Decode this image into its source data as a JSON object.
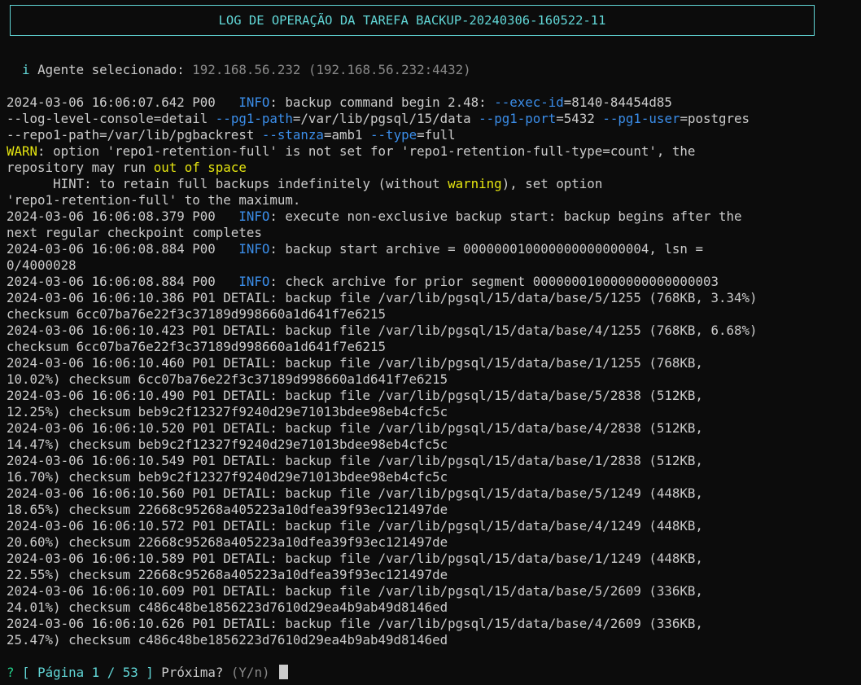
{
  "title": "LOG DE OPERAÇÃO DA TAREFA BACKUP-20240306-160522-11",
  "agent": {
    "icon_text": "i",
    "label": "Agente selecionado:",
    "value": "192.168.56.232 (192.168.56.232:4432)"
  },
  "log_lines": [
    [
      {
        "t": "2024-03-06 16:06:07.642 P00   "
      },
      {
        "t": "INFO",
        "c": "blue"
      },
      {
        "t": ": backup command begin 2.48: "
      },
      {
        "t": "--exec-id",
        "c": "blue"
      },
      {
        "t": "=8140-84454d85"
      }
    ],
    [
      {
        "t": "--log-level-console=detail "
      },
      {
        "t": "--pg1-path",
        "c": "blue"
      },
      {
        "t": "=/var/lib/pgsql/15/data "
      },
      {
        "t": "--pg1-port",
        "c": "blue"
      },
      {
        "t": "=5432 "
      },
      {
        "t": "--pg1-user",
        "c": "blue"
      },
      {
        "t": "=postgres"
      }
    ],
    [
      {
        "t": "--repo1-path=/var/lib/pgbackrest "
      },
      {
        "t": "--stanza",
        "c": "blue"
      },
      {
        "t": "=amb1 "
      },
      {
        "t": "--type",
        "c": "blue"
      },
      {
        "t": "=full"
      }
    ],
    [
      {
        "t": "WARN",
        "c": "yellow"
      },
      {
        "t": ": option 'repo1-retention-full' is not set for 'repo1-retention-full-type=count', the"
      }
    ],
    [
      {
        "t": "repository may run "
      },
      {
        "t": "out of space",
        "c": "yellow"
      }
    ],
    [
      {
        "t": "      HINT: to retain full backups indefinitely (without "
      },
      {
        "t": "warning",
        "c": "yellow"
      },
      {
        "t": "), set option"
      }
    ],
    [
      {
        "t": "'repo1-retention-full' to the maximum."
      }
    ],
    [
      {
        "t": "2024-03-06 16:06:08.379 P00   "
      },
      {
        "t": "INFO",
        "c": "blue"
      },
      {
        "t": ": execute non-exclusive backup start: backup begins after the"
      }
    ],
    [
      {
        "t": "next regular checkpoint completes"
      }
    ],
    [
      {
        "t": "2024-03-06 16:06:08.884 P00   "
      },
      {
        "t": "INFO",
        "c": "blue"
      },
      {
        "t": ": backup start archive = 000000010000000000000004, lsn ="
      }
    ],
    [
      {
        "t": "0/4000028"
      }
    ],
    [
      {
        "t": "2024-03-06 16:06:08.884 P00   "
      },
      {
        "t": "INFO",
        "c": "blue"
      },
      {
        "t": ": check archive for prior segment 000000010000000000000003"
      }
    ],
    [
      {
        "t": "2024-03-06 16:06:10.386 P01 DETAIL: backup file /var/lib/pgsql/15/data/base/5/1255 (768KB, 3.34%)"
      }
    ],
    [
      {
        "t": "checksum 6cc07ba76e22f3c37189d998660a1d641f7e6215"
      }
    ],
    [
      {
        "t": "2024-03-06 16:06:10.423 P01 DETAIL: backup file /var/lib/pgsql/15/data/base/4/1255 (768KB, 6.68%)"
      }
    ],
    [
      {
        "t": "checksum 6cc07ba76e22f3c37189d998660a1d641f7e6215"
      }
    ],
    [
      {
        "t": "2024-03-06 16:06:10.460 P01 DETAIL: backup file /var/lib/pgsql/15/data/base/1/1255 (768KB,"
      }
    ],
    [
      {
        "t": "10.02%) checksum 6cc07ba76e22f3c37189d998660a1d641f7e6215"
      }
    ],
    [
      {
        "t": "2024-03-06 16:06:10.490 P01 DETAIL: backup file /var/lib/pgsql/15/data/base/5/2838 (512KB,"
      }
    ],
    [
      {
        "t": "12.25%) checksum beb9c2f12327f9240d29e71013bdee98eb4cfc5c"
      }
    ],
    [
      {
        "t": "2024-03-06 16:06:10.520 P01 DETAIL: backup file /var/lib/pgsql/15/data/base/4/2838 (512KB,"
      }
    ],
    [
      {
        "t": "14.47%) checksum beb9c2f12327f9240d29e71013bdee98eb4cfc5c"
      }
    ],
    [
      {
        "t": "2024-03-06 16:06:10.549 P01 DETAIL: backup file /var/lib/pgsql/15/data/base/1/2838 (512KB,"
      }
    ],
    [
      {
        "t": "16.70%) checksum beb9c2f12327f9240d29e71013bdee98eb4cfc5c"
      }
    ],
    [
      {
        "t": "2024-03-06 16:06:10.560 P01 DETAIL: backup file /var/lib/pgsql/15/data/base/5/1249 (448KB,"
      }
    ],
    [
      {
        "t": "18.65%) checksum 22668c95268a405223a10dfea39f93ec121497de"
      }
    ],
    [
      {
        "t": "2024-03-06 16:06:10.572 P01 DETAIL: backup file /var/lib/pgsql/15/data/base/4/1249 (448KB,"
      }
    ],
    [
      {
        "t": "20.60%) checksum 22668c95268a405223a10dfea39f93ec121497de"
      }
    ],
    [
      {
        "t": "2024-03-06 16:06:10.589 P01 DETAIL: backup file /var/lib/pgsql/15/data/base/1/1249 (448KB,"
      }
    ],
    [
      {
        "t": "22.55%) checksum 22668c95268a405223a10dfea39f93ec121497de"
      }
    ],
    [
      {
        "t": "2024-03-06 16:06:10.609 P01 DETAIL: backup file /var/lib/pgsql/15/data/base/5/2609 (336KB,"
      }
    ],
    [
      {
        "t": "24.01%) checksum c486c48be1856223d7610d29ea4b9ab49d8146ed"
      }
    ],
    [
      {
        "t": "2024-03-06 16:06:10.626 P01 DETAIL: backup file /var/lib/pgsql/15/data/base/4/2609 (336KB,"
      }
    ],
    [
      {
        "t": "25.47%) checksum c486c48be1856223d7610d29ea4b9ab49d8146ed"
      }
    ]
  ],
  "prompt": {
    "question_mark": "?",
    "bracket_open": "[",
    "page_label": "Página",
    "page_current": "1",
    "page_separator": "/",
    "page_total": "53",
    "bracket_close": "]",
    "next_label": "Próxima?",
    "options": "(Y/n)"
  },
  "colors": {
    "background": "#0c0c0c",
    "text": "#cccccc",
    "info": "#3b8eea",
    "warn": "#e5e510",
    "title": "#61d6d6",
    "muted": "#8a8a8a",
    "prompt_mark": "#23d18b"
  }
}
